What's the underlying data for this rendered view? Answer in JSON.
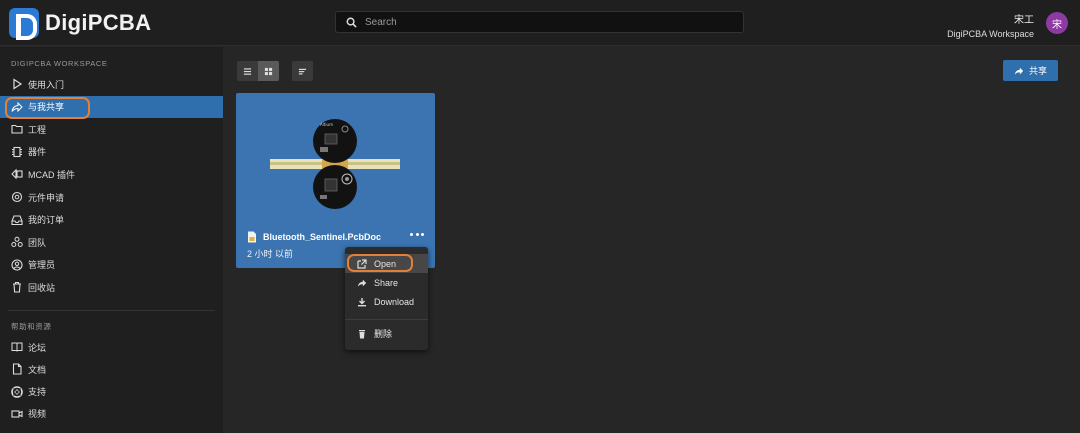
{
  "app": {
    "logo_text": "DigiPCBA"
  },
  "header": {
    "search_placeholder": "Search",
    "user_name": "宋工",
    "workspace_name": "DigiPCBA Workspace",
    "avatar_initial": "宋",
    "avatar_color": "#8e3aa3"
  },
  "sidebar": {
    "workspace_title": "DIGIPCBA WORKSPACE",
    "items": [
      {
        "label": "使用入门",
        "icon": "play-icon"
      },
      {
        "label": "与我共享",
        "icon": "share-icon",
        "active": true
      },
      {
        "label": "工程",
        "icon": "folder-icon"
      },
      {
        "label": "器件",
        "icon": "chip-icon"
      },
      {
        "label": "MCAD 插件",
        "icon": "mcad-icon"
      },
      {
        "label": "元件申请",
        "icon": "component-request-icon"
      },
      {
        "label": "我的订单",
        "icon": "inbox-icon"
      },
      {
        "label": "团队",
        "icon": "team-icon"
      },
      {
        "label": "管理员",
        "icon": "admin-icon"
      },
      {
        "label": "回收站",
        "icon": "trash-icon"
      }
    ],
    "help_title": "帮助和资源",
    "help_items": [
      {
        "label": "论坛",
        "icon": "book-icon"
      },
      {
        "label": "文档",
        "icon": "document-icon"
      },
      {
        "label": "支持",
        "icon": "lifebuoy-icon"
      },
      {
        "label": "视频",
        "icon": "video-icon"
      }
    ]
  },
  "toolbar": {
    "share_label": "共享"
  },
  "card": {
    "file_name": "Bluetooth_Sentinel.PcbDoc",
    "time": "2 小时 以前"
  },
  "context_menu": {
    "items": [
      {
        "label": "Open",
        "icon": "open-external-icon"
      },
      {
        "label": "Share",
        "icon": "share-arrow-icon"
      },
      {
        "label": "Download",
        "icon": "download-icon"
      },
      {
        "label": "删除",
        "icon": "delete-icon"
      }
    ]
  },
  "colors": {
    "accent": "#2f6fad",
    "card_bg": "#3b74b0",
    "highlight": "#e0813a"
  }
}
